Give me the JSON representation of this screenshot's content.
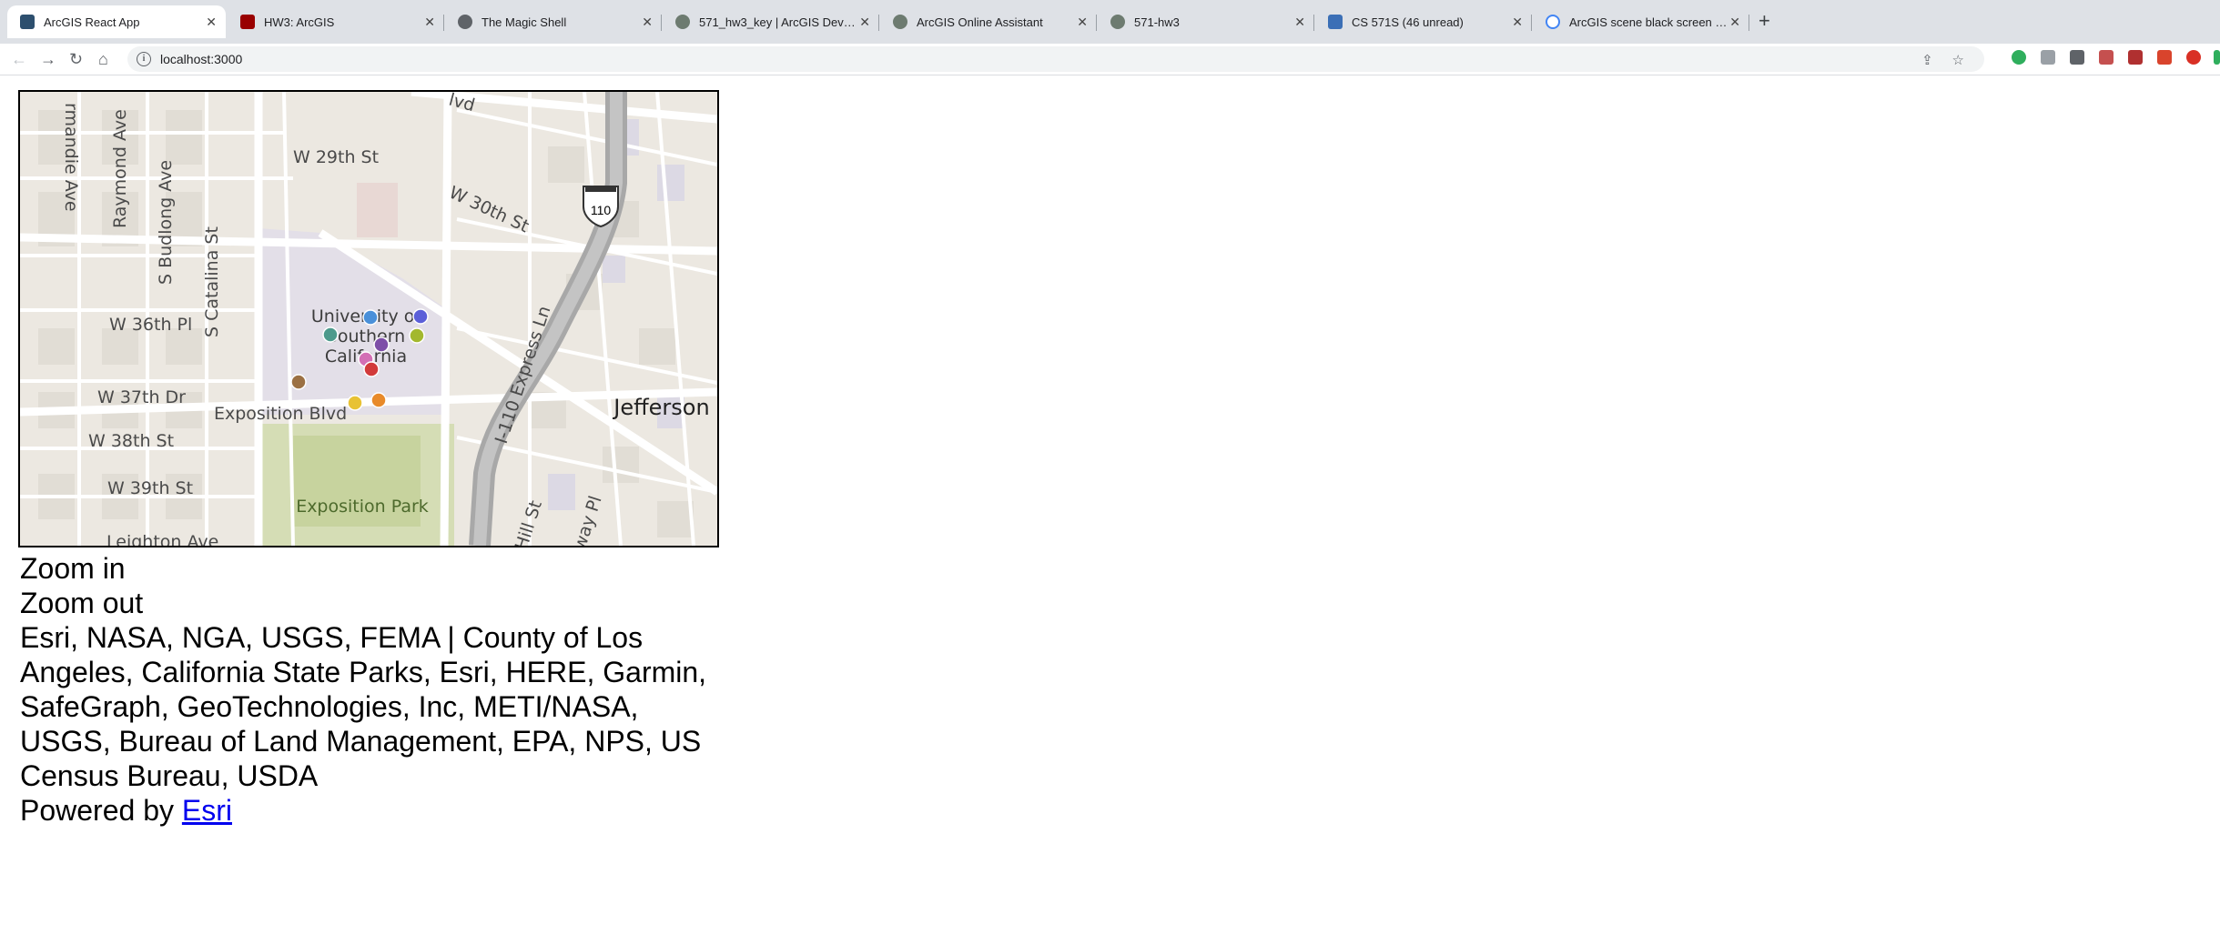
{
  "browser": {
    "tabs": [
      {
        "title": "ArcGIS React App",
        "active": true,
        "favicon": "arcgis-icon"
      },
      {
        "title": "HW3: ArcGIS",
        "active": false,
        "favicon": "usc-icon"
      },
      {
        "title": "The Magic Shell",
        "active": false,
        "favicon": "globe-icon"
      },
      {
        "title": "571_hw3_key | ArcGIS Develop",
        "active": false,
        "favicon": "arcgis-globe-icon"
      },
      {
        "title": "ArcGIS Online Assistant",
        "active": false,
        "favicon": "arcgis-globe-icon"
      },
      {
        "title": "571-hw3",
        "active": false,
        "favicon": "arcgis-globe-icon"
      },
      {
        "title": "CS 571S (46 unread)",
        "active": false,
        "favicon": "piazza-icon"
      },
      {
        "title": "ArcGIS scene black screen rea",
        "active": false,
        "favicon": "google-icon"
      }
    ],
    "url": "localhost:3000"
  },
  "map": {
    "street_labels": [
      "rmandie Ave",
      "Raymond Ave",
      "S Budlong Ave",
      "S Catalina St",
      "W 29th St",
      "W 30th St",
      "W 36th Pl",
      "W 37th Dr",
      "W 38th St",
      "W 39th St",
      "Exposition Blvd",
      "Leighton Ave",
      "I-110 Express Ln",
      "Hill St",
      "way Pl",
      "lvd"
    ],
    "place_labels": [
      "University of",
      "Southern",
      "California",
      "Jefferson",
      "Exposition Park"
    ],
    "shield_label": "110",
    "markers": [
      {
        "color": "#4a90d9"
      },
      {
        "color": "#5b5fd8"
      },
      {
        "color": "#4d9a8c"
      },
      {
        "color": "#a3b82e"
      },
      {
        "color": "#7e4fa8"
      },
      {
        "color": "#d36fb5"
      },
      {
        "color": "#d23a3a"
      },
      {
        "color": "#9b7043"
      },
      {
        "color": "#e8c234"
      },
      {
        "color": "#e88a2a"
      }
    ]
  },
  "page": {
    "zoom_in": "Zoom in",
    "zoom_out": "Zoom out",
    "attribution": "Esri, NASA, NGA, USGS, FEMA | County of Los Angeles, California State Parks, Esri, HERE, Garmin, SafeGraph, GeoTechnologies, Inc, METI/NASA, USGS, Bureau of Land Management, EPA, NPS, US Census Bureau, USDA",
    "powered_by": "Powered by ",
    "esri_link": "Esri"
  }
}
